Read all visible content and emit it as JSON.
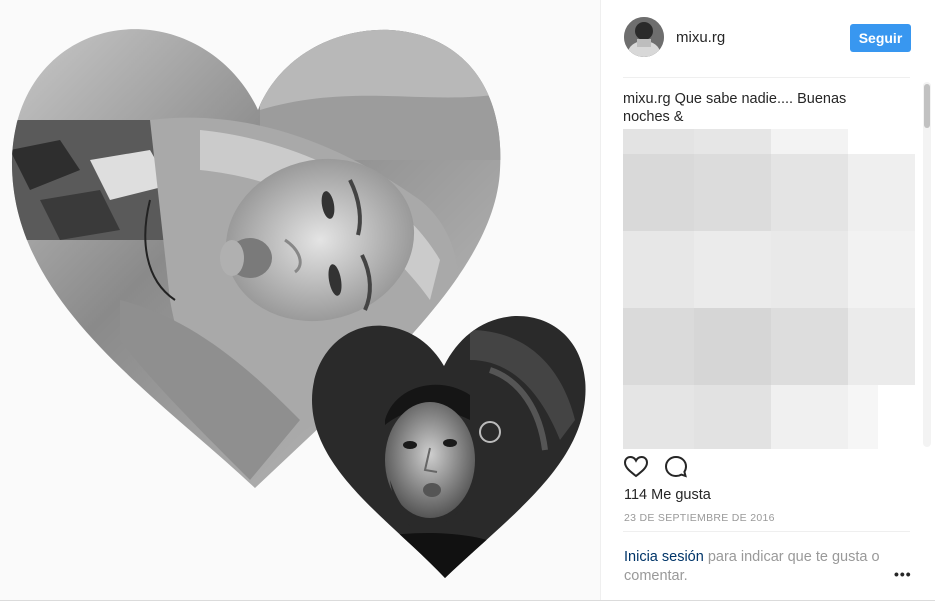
{
  "post": {
    "username": "mixu.rg",
    "follow_label": "Seguir",
    "caption_user": "mixu.rg",
    "caption_text": "Que sabe nadie.... Buenas noches &",
    "likes": "114 Me gusta",
    "date": "23 DE SEPTIEMBRE DE 2016",
    "login_link": "Inicia sesión",
    "login_rest": "para indicar que te gusta o comentar.",
    "more_label": "•••"
  },
  "icons": {
    "like": "heart-outline-icon",
    "comment": "comment-bubble-icon",
    "more": "more-options-icon"
  },
  "colors": {
    "follow_button": "#3897f0",
    "link": "#003569",
    "muted": "#999999",
    "text": "#262626"
  }
}
